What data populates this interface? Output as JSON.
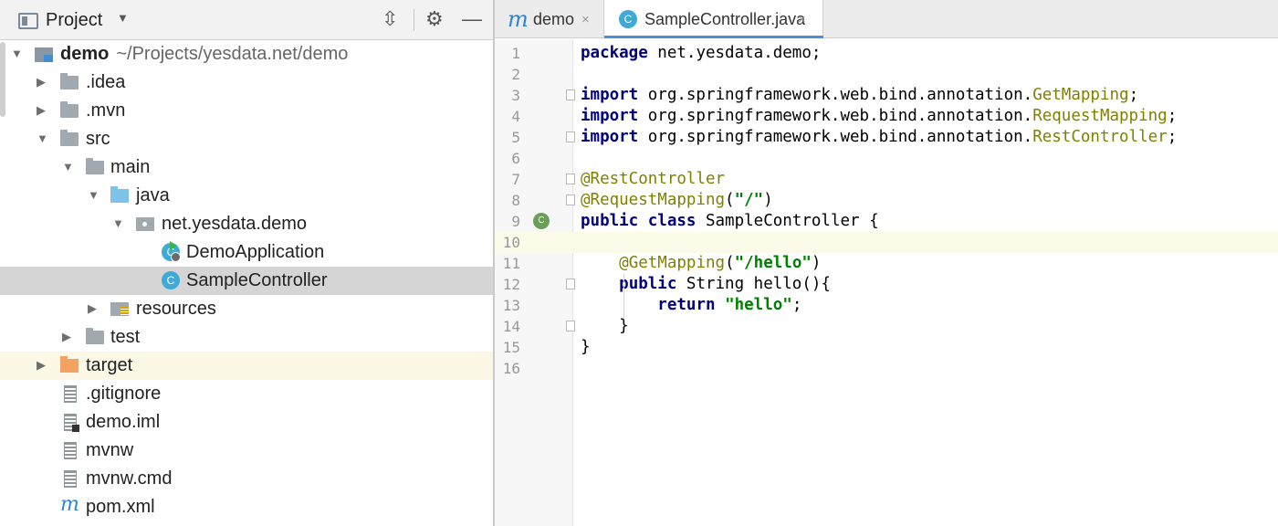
{
  "project_panel": {
    "title": "Project",
    "dropdown_glyph": "▼",
    "tools": {
      "collapse_icon": "collapse-all-icon",
      "settings_icon": "gear-icon",
      "hide_icon": "minimize-icon"
    },
    "tree": [
      {
        "label": "demo",
        "path": "~/Projects/yesdata.net/demo",
        "arrow": "▼",
        "icon": "module-folder-icon"
      },
      {
        "label": ".idea",
        "arrow": "▶",
        "icon": "folder-icon"
      },
      {
        "label": ".mvn",
        "arrow": "▶",
        "icon": "folder-icon"
      },
      {
        "label": "src",
        "arrow": "▼",
        "icon": "folder-icon"
      },
      {
        "label": "main",
        "arrow": "▼",
        "icon": "folder-icon"
      },
      {
        "label": "java",
        "arrow": "▼",
        "icon": "source-folder-icon"
      },
      {
        "label": "net.yesdata.demo",
        "arrow": "▼",
        "icon": "package-icon"
      },
      {
        "label": "DemoApplication",
        "arrow": "",
        "icon": "spring-boot-class-icon"
      },
      {
        "label": "SampleController",
        "arrow": "",
        "icon": "class-icon"
      },
      {
        "label": "resources",
        "arrow": "▶",
        "icon": "resources-folder-icon"
      },
      {
        "label": "test",
        "arrow": "▶",
        "icon": "folder-icon"
      },
      {
        "label": "target",
        "arrow": "▶",
        "icon": "excluded-folder-icon"
      },
      {
        "label": ".gitignore",
        "arrow": "",
        "icon": "text-file-icon"
      },
      {
        "label": "demo.iml",
        "arrow": "",
        "icon": "module-file-icon"
      },
      {
        "label": "mvnw",
        "arrow": "",
        "icon": "text-file-icon"
      },
      {
        "label": "mvnw.cmd",
        "arrow": "",
        "icon": "text-file-icon"
      },
      {
        "label": "pom.xml",
        "arrow": "",
        "icon": "maven-icon"
      }
    ]
  },
  "editor": {
    "tabs": [
      {
        "label": "demo",
        "icon": "maven-icon",
        "close": "×"
      },
      {
        "label": "SampleController.java",
        "icon": "class-icon",
        "close": "×",
        "active": true
      }
    ],
    "class_glyph": "C",
    "maven_glyph": "m",
    "line_numbers": [
      "1",
      "2",
      "3",
      "4",
      "5",
      "6",
      "7",
      "8",
      "9",
      "10",
      "11",
      "12",
      "13",
      "14",
      "15",
      "16"
    ],
    "code": {
      "l1_kw": "package",
      "l1_rest": " net.yesdata.demo;",
      "import_kw": "import",
      "l3_pkg": " org.springframework.web.bind.annotation.",
      "l3_cls": "GetMapping",
      "l3_end": ";",
      "l4_pkg": " org.springframework.web.bind.annotation.",
      "l4_cls": "RequestMapping",
      "l4_end": ";",
      "l5_pkg": " org.springframework.web.bind.annotation.",
      "l5_cls": "RestController",
      "l5_end": ";",
      "l7_ann": "@RestController",
      "l8_ann": "@RequestMapping",
      "l8_open": "(",
      "l8_str": "\"/\"",
      "l8_close": ")",
      "l9_kw": "public class",
      "l9_rest": " SampleController {",
      "l11_indent": "    ",
      "l11_ann": "@GetMapping",
      "l11_open": "(",
      "l11_str": "\"/hello\"",
      "l11_close": ")",
      "l12_indent": "    ",
      "l12_kw": "public",
      "l12_rest": " String hello(){",
      "l13_indent": "        ",
      "l13_kw": "return",
      "l13_sp": " ",
      "l13_str": "\"hello\"",
      "l13_end": ";",
      "l14_text": "    }",
      "l15_text": "}"
    }
  }
}
